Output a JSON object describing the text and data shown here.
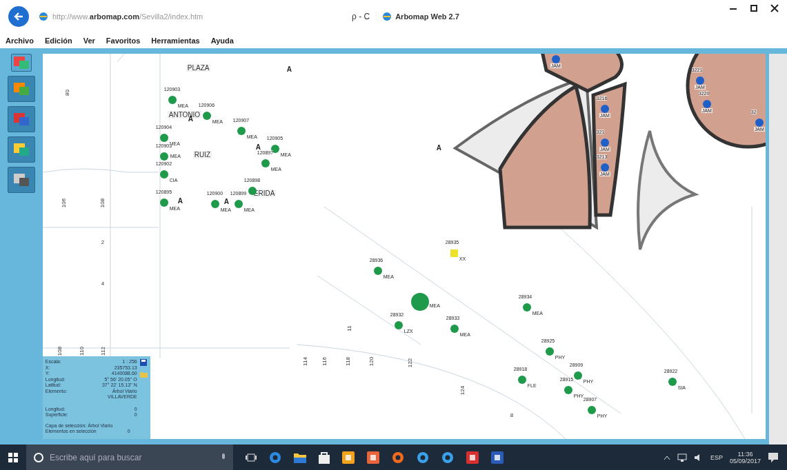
{
  "browser": {
    "address": "http://www.**arbomap.com**/Sevilla2/index.htm",
    "search_glyph": "ρ - C",
    "tab_title": "Arbomap Web 2.7"
  },
  "menu": [
    "Archivo",
    "Edición",
    "Ver",
    "Favoritos",
    "Herramientas",
    "Ayuda"
  ],
  "map": {
    "street_labels": [
      "PLAZA",
      "ANTONIO",
      "RUIZ",
      "ERIDA"
    ],
    "road_marks": [
      "A",
      "A",
      "A",
      "A",
      "A",
      "A"
    ],
    "parcel_numbers": [
      "80",
      "106",
      "108",
      "2",
      "4",
      "108",
      "110",
      "112",
      "114",
      "116",
      "118",
      "120",
      "122",
      "124",
      "11",
      "8"
    ],
    "markers": [
      {
        "kind": "circle",
        "color": "#1e9a4a",
        "id": "120903",
        "code": "MEA"
      },
      {
        "kind": "circle",
        "color": "#1e9a4a",
        "id": "120906",
        "code": "MEA"
      },
      {
        "kind": "circle",
        "color": "#1e9a4a",
        "id": "120904",
        "code": "MEA"
      },
      {
        "kind": "circle",
        "color": "#1e9a4a",
        "id": "120907",
        "code": "MEA"
      },
      {
        "kind": "circle",
        "color": "#1e9a4a",
        "id": "120903",
        "code": "MEA"
      },
      {
        "kind": "circle",
        "color": "#1e9a4a",
        "id": "120905",
        "code": "MEA"
      },
      {
        "kind": "circle",
        "color": "#1e9a4a",
        "id": "120897",
        "code": "MEA"
      },
      {
        "kind": "circle",
        "color": "#1e9a4a",
        "id": "120902",
        "code": "CIA"
      },
      {
        "kind": "circle",
        "color": "#1e9a4a",
        "id": "120898"
      },
      {
        "kind": "circle",
        "color": "#1e9a4a",
        "id": "120895",
        "code": "MEA"
      },
      {
        "kind": "circle",
        "color": "#1e9a4a",
        "id": "120900",
        "code": "MEA"
      },
      {
        "kind": "circle",
        "color": "#1e9a4a",
        "id": "120899",
        "code": "MEA"
      },
      {
        "kind": "circle",
        "color": "#1e9a4a",
        "id": "28936",
        "code": "MEA"
      },
      {
        "kind": "square",
        "color": "#ece22a",
        "id": "28935",
        "code": "XX"
      },
      {
        "kind": "large",
        "color": "#1e9a4a",
        "code": "MEA"
      },
      {
        "kind": "circle",
        "color": "#1e9a4a",
        "id": "28932",
        "code": "LZX"
      },
      {
        "kind": "circle",
        "color": "#1e9a4a",
        "id": "28933",
        "code": "MEA"
      },
      {
        "kind": "circle",
        "color": "#1e9a4a",
        "id": "28934",
        "code": "MEA"
      },
      {
        "kind": "circle",
        "color": "#1e9a4a",
        "id": "28925",
        "code": "PHY"
      },
      {
        "kind": "circle",
        "color": "#1e9a4a",
        "id": "28918",
        "code": "FLE"
      },
      {
        "kind": "circle",
        "color": "#1e9a4a",
        "id": "28909",
        "code": "PHY"
      },
      {
        "kind": "circle",
        "color": "#1e9a4a",
        "id": "28915",
        "code": "PHY"
      },
      {
        "kind": "circle",
        "color": "#1e9a4a",
        "id": "28907",
        "code": "PHY"
      },
      {
        "kind": "circle",
        "color": "#1e9a4a",
        "id": "28922",
        "code": "SIA"
      },
      {
        "kind": "circle",
        "color": "#1f5fc8",
        "code": "JAM"
      },
      {
        "kind": "circle",
        "color": "#1f5fc8",
        "id": "3216",
        "code": "JAM"
      },
      {
        "kind": "circle",
        "color": "#1f5fc8",
        "id": "321",
        "code": "JAM"
      },
      {
        "kind": "circle",
        "color": "#1f5fc8",
        "id": "3213",
        "code": "JAM"
      },
      {
        "kind": "circle",
        "color": "#1f5fc8",
        "id": "3221",
        "code": "JAM"
      },
      {
        "kind": "circle",
        "color": "#1f5fc8",
        "id": "3220",
        "code": "JAM"
      },
      {
        "kind": "circle",
        "color": "#1f5fc8",
        "id": "32",
        "code": "JAM"
      }
    ]
  },
  "info_panel": {
    "rows": [
      {
        "label": "Escala:",
        "value": "1 : 256"
      },
      {
        "label": "X:",
        "value": "235753.13"
      },
      {
        "label": "Y:",
        "value": "4140088.60"
      },
      {
        "label": "Longitud:",
        "value": "5° 56' 20.05'' O"
      },
      {
        "label": "Latitud:",
        "value": "37° 22' 15.13'' N"
      },
      {
        "label": "Elemento:",
        "value": "Árbol Viario"
      },
      {
        "value": "VILLAVERDE"
      },
      {
        "label": "Longitud:",
        "value": "0"
      },
      {
        "label": "Superficie:",
        "value": "0"
      }
    ],
    "selection_layer": "Capa de selección: Árbol Viario",
    "selection_count_label": "Elementos en selección",
    "selection_count": "0"
  },
  "taskbar": {
    "search_placeholder": "Escribe aquí para buscar",
    "language": "ESP",
    "time": "11:36",
    "date": "05/09/2017"
  }
}
